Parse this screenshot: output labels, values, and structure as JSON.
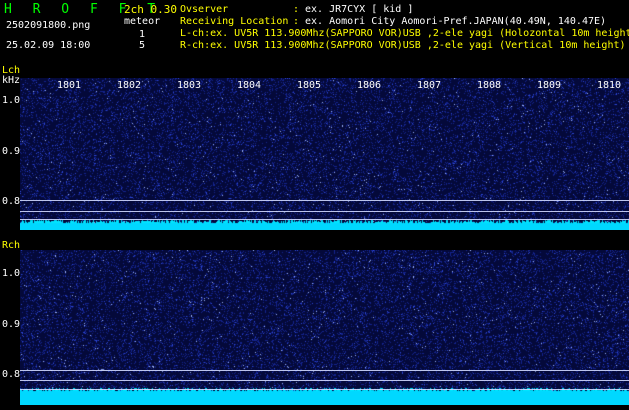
{
  "header": {
    "logo": "H R O F F T",
    "version": "2ch 0.30",
    "filename": "2502091800.png",
    "datetime": "25.02.09 18:00",
    "meteor_label": "meteor",
    "l_count": "1",
    "r_count": "5",
    "observer_label": "Ovserver",
    "observer_value": "ex. JR7CYX [ kid ]",
    "location_label": "Receiving Location",
    "location_value": "ex. Aomori City Aomori-Pref.JAPAN(40.49N, 140.47E)",
    "lch_info": "L-ch:ex. UV5R 113.900Mhz(SAPPORO VOR)USB ,2-ele yagi (Holozontal 10m height)",
    "rch_info": "R-ch:ex. UV5R 113.900Mhz(SAPPORO VOR)USB ,2-ele yagi (Vertical 10m height)",
    "colon": ":"
  },
  "lch": {
    "label": "Lch",
    "unit": "kHz",
    "time_ticks": [
      "1801",
      "1802",
      "1803",
      "1804",
      "1805",
      "1806",
      "1807",
      "1808",
      "1809",
      "1810"
    ],
    "freq_ticks": [
      "1.0",
      "0.9",
      "0.8"
    ]
  },
  "rch": {
    "label": "Rch",
    "freq_ticks": [
      "1.0",
      "0.9",
      "0.8"
    ]
  },
  "colors": {
    "background": "#000000",
    "logo": "#00ff00",
    "accent_text": "#ffff00",
    "noise_floor": "#00e5ff",
    "spectrogram_bg": "#050a40"
  }
}
